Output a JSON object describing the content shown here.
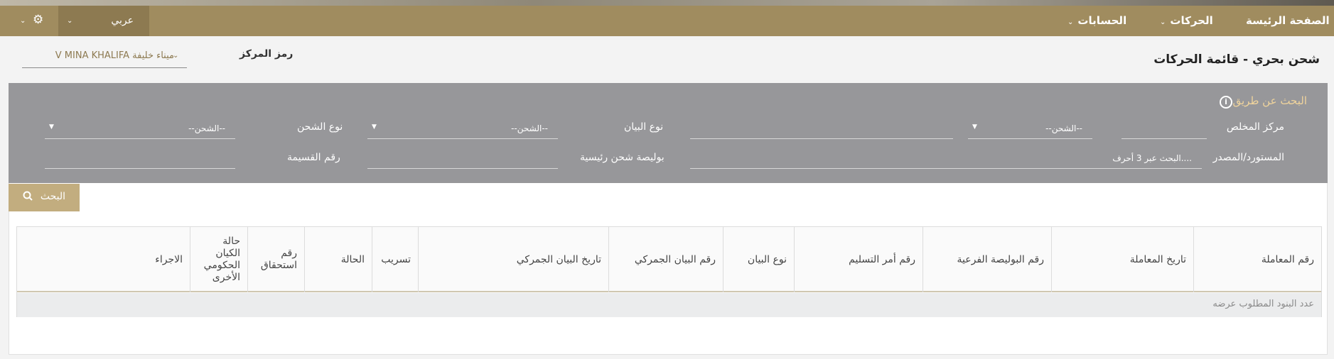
{
  "nav": {
    "home": "الصفحة الرئيسة",
    "movements": "الحركات",
    "accounts": "الحسابات",
    "language": "عربي"
  },
  "page": {
    "title": "شحن بحري - قائمة الحركات",
    "center_code_label": "رمز المركز",
    "center_code_value": "V MINA KHALIFA ميناء خليفة"
  },
  "search": {
    "title": "البحث عن طريق",
    "fields": {
      "clearing_center": {
        "label": "مركز المخلص",
        "value": ""
      },
      "declaration_type": {
        "label": "نوع البيان",
        "value": ""
      },
      "shipment_type": {
        "label": "نوع الشحن",
        "value": "--الشحن--"
      },
      "clearing_select": {
        "value": "--الشحن--"
      },
      "declaration_select": {
        "value": "--الشحن--"
      },
      "importer_source": {
        "label": "المستورد/المصدر",
        "placeholder": "البحث عبر 3 أحرف...."
      },
      "master_bl": {
        "label": "بوليصة شحن رئيسية",
        "value": ""
      },
      "voucher_no": {
        "label": "رقم القسيمة",
        "value": ""
      }
    },
    "button_label": "البحث"
  },
  "table": {
    "columns": [
      "رقم المعاملة",
      "تاريخ المعاملة",
      "رقم البوليصة الفرعية",
      "رقم أمر التسليم",
      "نوع البيان",
      "رقم البيان الجمركي",
      "تاريخ البيان الجمركي",
      "تسريب",
      "الحالة",
      "رقم استحقاق",
      "حالة الكيان الحكومي الأخرى",
      "الاجراء"
    ],
    "footer_text": "عدد البنود المطلوب عرضه"
  },
  "colors": {
    "nav_bg": "#a08c5f",
    "search_bg": "#97979a",
    "accent": "#c2ad7f"
  }
}
